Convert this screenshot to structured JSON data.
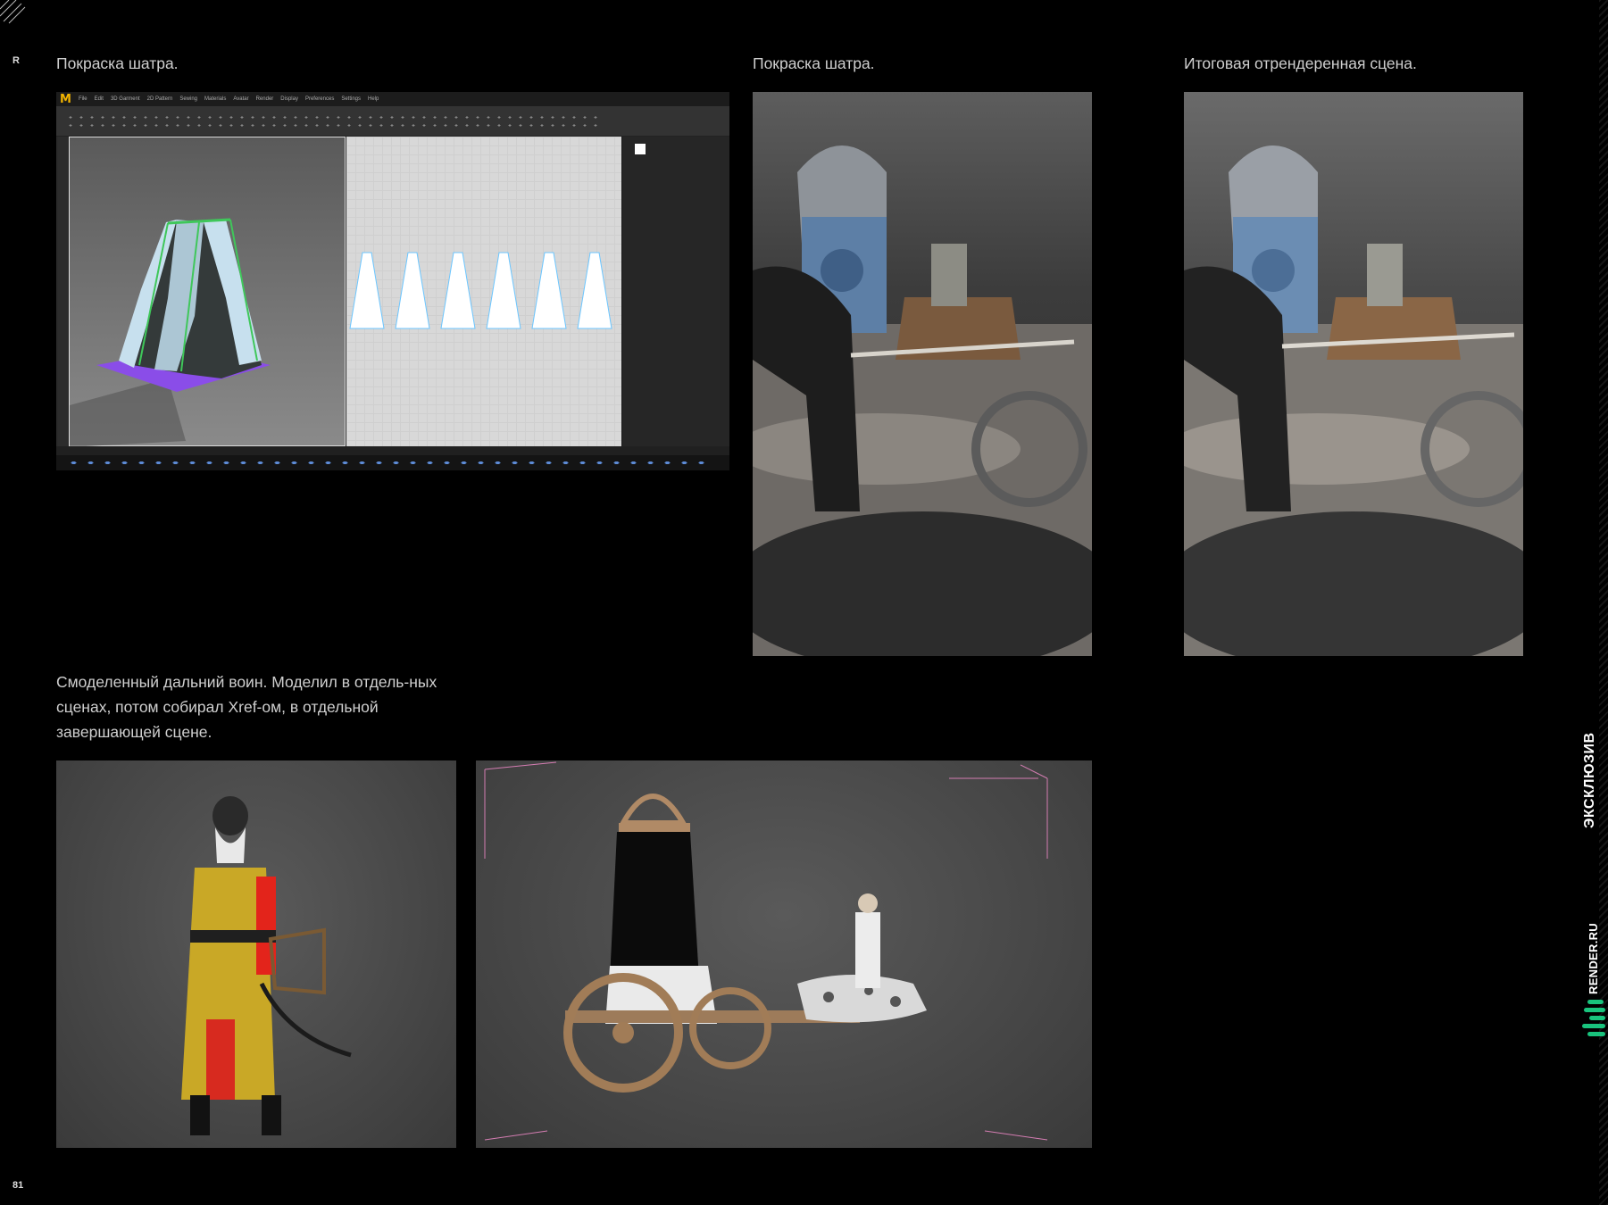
{
  "captions": {
    "top_left": "Покраска шатра.",
    "top_middle": "Покраска шатра.",
    "top_right": "Итоговая отрендеренная сцена.",
    "bottom": "Смоделенный дальний воин. Моделил в отдель-ных сценах, потом собирал Xref-ом, в отдельной завершающей сцене."
  },
  "corner_mark": "R",
  "page_number": "81",
  "side": {
    "exclusive": "ЭКСКЛЮЗИВ",
    "brand": "RENDER.RU"
  },
  "software": {
    "logo": "M",
    "menu": [
      "File",
      "Edit",
      "3D Garment",
      "2D Pattern",
      "Sewing",
      "Materials",
      "Avatar",
      "Render",
      "Display",
      "Preferences",
      "Settings",
      "Help"
    ]
  },
  "colors": {
    "background": "#000000",
    "caption_text": "#cfcfcf",
    "brand_green": "#19c37d",
    "accent_yellow": "#f2b400",
    "tent_green": "#3fc75a",
    "tent_purple": "#8a4de8"
  },
  "icons": [
    "logo-m-icon",
    "toolbar-icons",
    "taskbar-icons"
  ]
}
